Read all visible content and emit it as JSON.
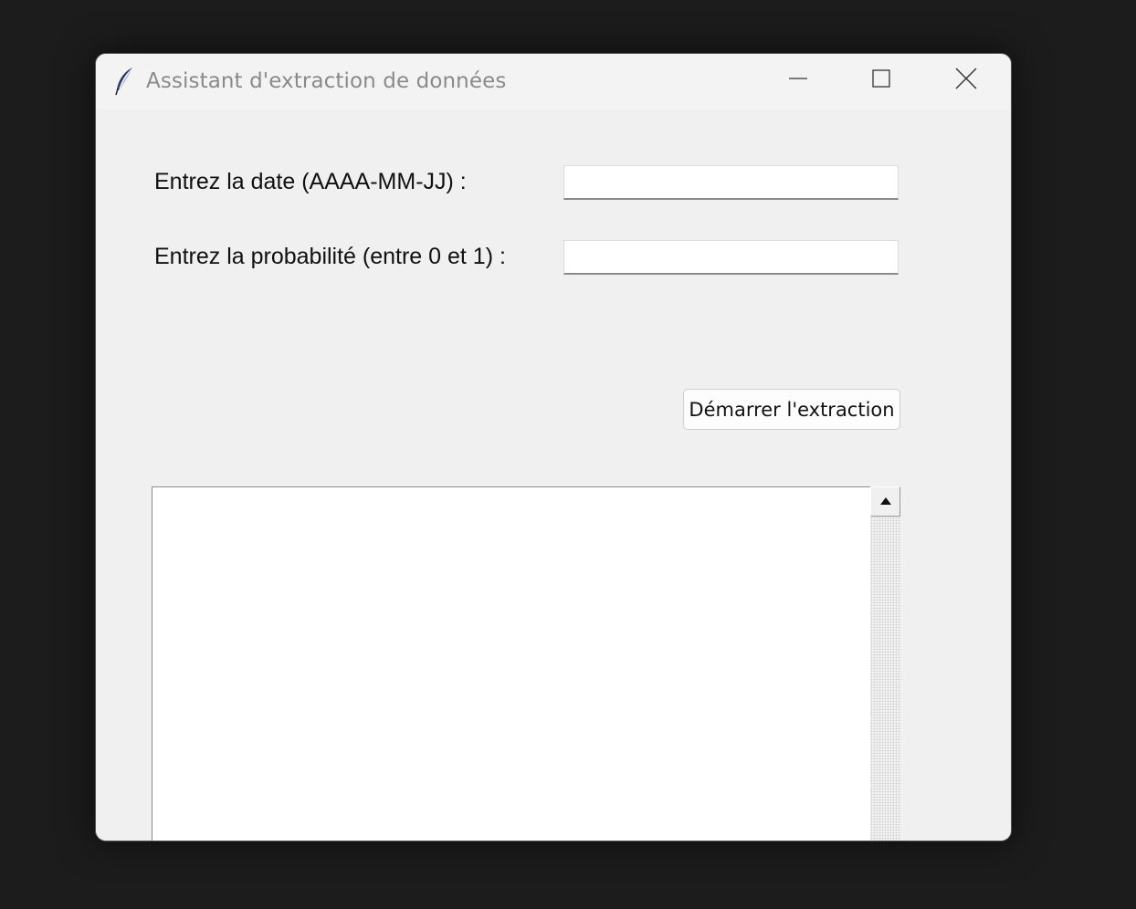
{
  "window": {
    "title": "Assistant d'extraction de données",
    "icon": "feather-icon",
    "controls": [
      "minimize-icon",
      "maximize-icon",
      "close-icon"
    ]
  },
  "form": {
    "date_label": "Entrez la date (AAAA-MM-JJ) :",
    "date_value": "",
    "probability_label": "Entrez la probabilité (entre 0 et 1) :",
    "probability_value": "",
    "start_button_label": "Démarrer l'extraction"
  },
  "output": {
    "text": "",
    "scroll_up_icon": "triangle-up-icon"
  }
}
